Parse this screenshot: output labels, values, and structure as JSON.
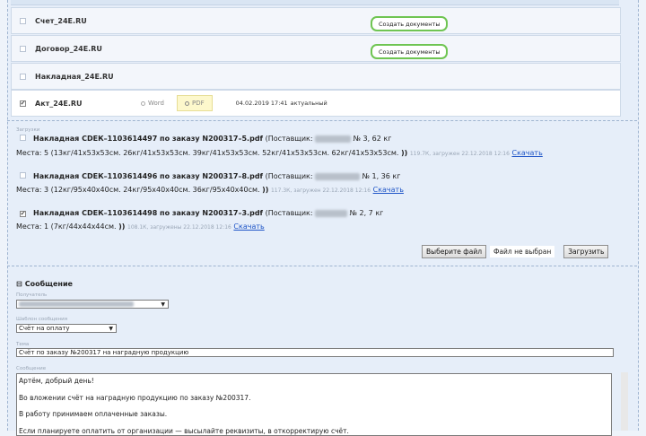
{
  "docs": [
    {
      "name": "Счет_24Е.RU",
      "create_label": "Создать документы"
    },
    {
      "name": "Договор_24Е.RU",
      "create_label": "Создать документы"
    },
    {
      "name": "Накладная_24Е.RU"
    },
    {
      "name": "Акт_24Е.RU",
      "opt_word": "Word",
      "opt_pdf": "PDF",
      "date": "04.02.2019 17:41",
      "status": "актуальный"
    }
  ],
  "uploads_label": "Загрузки",
  "uploads": [
    {
      "title": "Накладная СDЕК–1103614497 по заказу N200317–5.pdf",
      "supplier_prefix": "(Поставщик:",
      "supplier_tail": "№ 3, 62 кг",
      "places": "Места: 5 (13кг/41х53х53см. 26кг/41х53х53см. 39кг/41х53х53см. 52кг/41х53х53см. 62кг/41х53х53см.",
      "size": "119.7К, загружен 22.12.2018 12:16",
      "download": "Скачать"
    },
    {
      "title": "Накладная СDЕК–1103614496 по заказу N200317–8.pdf",
      "supplier_prefix": "(Поставщик:",
      "supplier_tail": "№ 1, 36 кг",
      "places": "Места: 3 (12кг/95х40х40см. 24кг/95х40х40см. 36кг/95х40х40см.",
      "size": "117.3К, загружен 22.12.2018 12:16",
      "download": "Скачать"
    },
    {
      "title": "Накладная СDЕК–1103614498 по заказу N200317–3.pdf",
      "supplier_prefix": "(Поставщик:",
      "supplier_tail": "№ 2, 7 кг",
      "places": "Места: 1 (7кг/44х44х44см.",
      "size": "108.1К, загружены 22.12.2018 12:16",
      "download": "Скачать"
    }
  ],
  "file": {
    "choose": "Выберите файл",
    "none": "Файл не выбран",
    "upload": "Загрузить"
  },
  "message": {
    "title": "Сообщение",
    "recipient_label": "Получатель",
    "template_label": "Шаблон сообщения",
    "template_value": "Счёт на оплату",
    "subject_label": "Тема",
    "subject_value": "Счёт по заказу №200317 на наградную продукцию",
    "body_label": "Сообщение",
    "body": [
      "Артём, добрый день!",
      "Во вложении счёт на наградную продукцию по заказу №200317.",
      "В работу принимаем оплаченные заказы.",
      "Если планируете оплатить от организации — высылайте реквизиты, в откорректирую счёт."
    ]
  }
}
